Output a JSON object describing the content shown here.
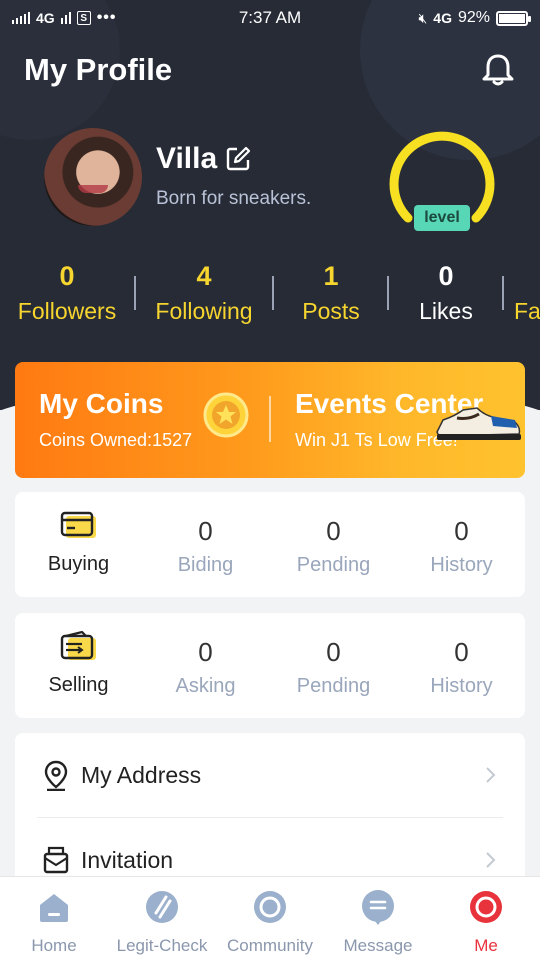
{
  "status_bar": {
    "network": "4G",
    "time": "7:37 AM",
    "network_right": "4G",
    "battery": "92%"
  },
  "header": {
    "title": "My Profile"
  },
  "profile": {
    "name": "Villa",
    "bio": "Born for sneakers.",
    "level_label": "level"
  },
  "stats": [
    {
      "value": "0",
      "label": "Followers"
    },
    {
      "value": "4",
      "label": "Following"
    },
    {
      "value": "1",
      "label": "Posts"
    },
    {
      "value": "0",
      "label": "Likes"
    },
    {
      "value": "",
      "label": "Fa"
    }
  ],
  "banner": {
    "coins_title": "My Coins",
    "coins_sub": "Coins Owned:1527",
    "events_title": "Events Center",
    "events_sub": "Win J1 Ts Low Free!"
  },
  "buying": {
    "label": "Buying",
    "cols": [
      {
        "value": "0",
        "label": "Biding"
      },
      {
        "value": "0",
        "label": "Pending"
      },
      {
        "value": "0",
        "label": "History"
      }
    ]
  },
  "selling": {
    "label": "Selling",
    "cols": [
      {
        "value": "0",
        "label": "Asking"
      },
      {
        "value": "0",
        "label": "Pending"
      },
      {
        "value": "0",
        "label": "History"
      }
    ]
  },
  "menu": [
    {
      "label": "My Address",
      "icon": "location-pin-icon"
    },
    {
      "label": "Invitation",
      "icon": "envelope-icon"
    }
  ],
  "tabs": [
    {
      "label": "Home",
      "icon": "home-icon",
      "active": false
    },
    {
      "label": "Legit-Check",
      "icon": "legit-check-icon",
      "active": false
    },
    {
      "label": "Community",
      "icon": "community-icon",
      "active": false
    },
    {
      "label": "Message",
      "icon": "message-icon",
      "active": false
    },
    {
      "label": "Me",
      "icon": "me-icon",
      "active": true
    }
  ],
  "colors": {
    "header_bg": "#262b36",
    "accent_yellow": "#f7d52f",
    "accent_red": "#e8323c",
    "banner_orange": "#ff7a12",
    "level_badge": "#58d7b6"
  }
}
